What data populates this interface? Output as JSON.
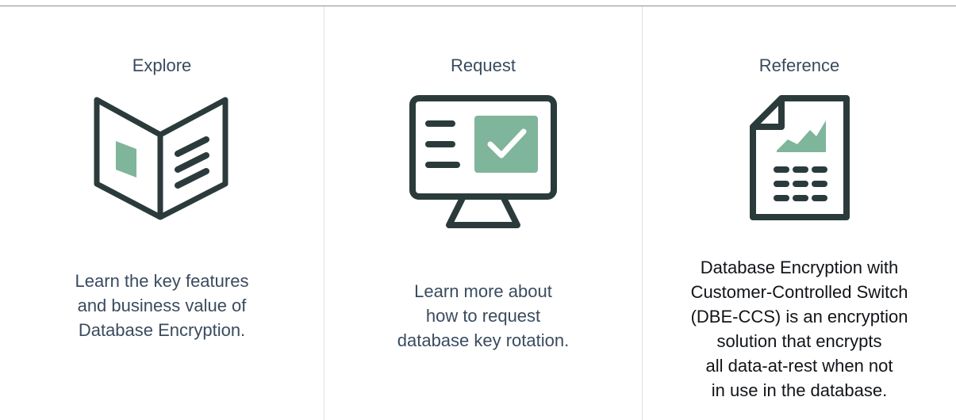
{
  "colors": {
    "dark": "#2b3b3b",
    "accent": "#7fb59a",
    "link_text": "#3a4b5e",
    "body_text": "#111418"
  },
  "cards": [
    {
      "title": "Explore",
      "icon": "open-book-icon",
      "lines": [
        "Learn the key features",
        "and business value of",
        "Database Encryption."
      ]
    },
    {
      "title": "Request",
      "icon": "monitor-checkmark-icon",
      "lines": [
        "Learn more about",
        "how to request",
        "database key rotation."
      ]
    },
    {
      "title": "Reference",
      "icon": "report-document-icon",
      "lines": [
        "Database Encryption with",
        "Customer-Controlled Switch",
        "(DBE-CCS) is an encryption",
        "solution that encrypts",
        "all data-at-rest when not",
        "in use in the database."
      ]
    }
  ]
}
